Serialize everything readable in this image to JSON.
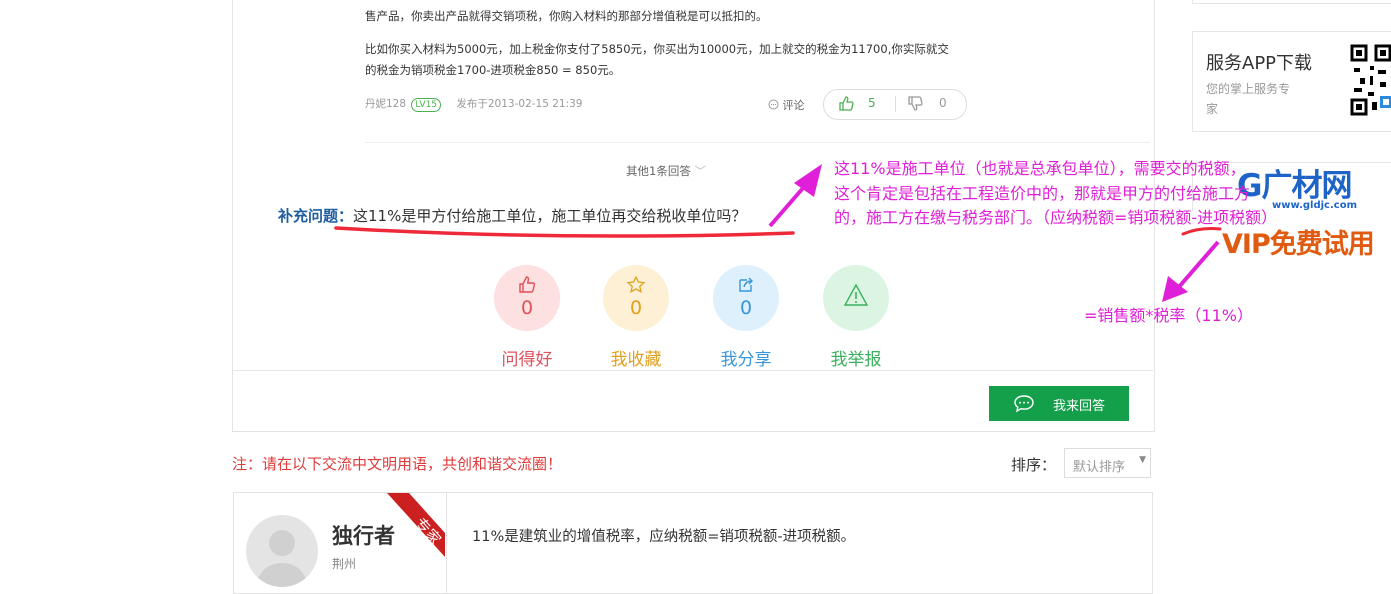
{
  "answer": {
    "lines": [
      "售产品，你卖出产品就得交销项税，你购入材料的那部分增值税是可以抵扣的。",
      "比如你买入材料为5000元，加上税金你支付了5850元，你买出为10000元，加上就交的税金为11700,你实际就交",
      "的税金为销项税金1700-进项税金850 = 850元。"
    ],
    "author": "丹妮128",
    "level": "LV15",
    "published": "发布于2013-02-15 21:39",
    "comment_label": "评论",
    "like_count": "5",
    "dislike_count": "0"
  },
  "other_answers": "其他1条回答",
  "supplement": {
    "label": "补充问题：",
    "text": "这11%是甲方付给施工单位，施工单位再交给税收单位吗？"
  },
  "actions": [
    {
      "count": "0",
      "label": "问得好",
      "color": "#e0505a",
      "bg": "#fde0e0"
    },
    {
      "count": "0",
      "label": "我收藏",
      "color": "#e0a020",
      "bg": "#fdf0d5"
    },
    {
      "count": "0",
      "label": "我分享",
      "color": "#3a96d8",
      "bg": "#ddf0fb"
    },
    {
      "count": "",
      "label": "我举报",
      "color": "#3cb060",
      "bg": "#dcf5e2"
    }
  ],
  "answer_button": "我来回答",
  "notice": "注：请在以下交流中文明用语，共创和谐交流圈！",
  "sort": {
    "label": "排序：",
    "selected": "默认排序"
  },
  "sidebar": {
    "app_title": "服务APP下载",
    "app_sub_1": "您的掌上服务专",
    "app_sub_2": "家",
    "brand": "G广材网",
    "brand_url": "www.gldjc.com",
    "vip": "VIP免费试用"
  },
  "annotations": {
    "note_lines": [
      "这11%是施工单位（也就是总承包单位），需要交的税额，",
      "这个肯定是包括在工程造价中的，那就是甲方的付给施工方",
      "的，施工方在缴与税务部门。（应纳税额=销项税额-进项税额）"
    ],
    "formula": "=销售额*税率（11%）",
    "color": "#e020d8"
  },
  "comment": {
    "name": "独行者",
    "location": "荆州",
    "badge": "专家",
    "text": "11%是建筑业的增值税率，应纳税额=销项税额-进项税额。"
  }
}
